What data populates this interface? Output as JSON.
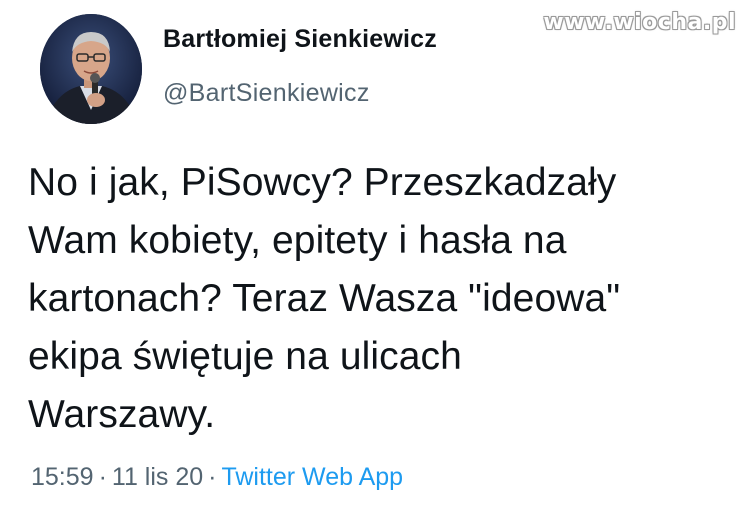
{
  "watermark": "www.wiocha.pl",
  "author": {
    "display_name": "Bartłomiej Sienkiewicz",
    "handle": "@BartSienkiewicz",
    "avatar_icon": "profile-photo"
  },
  "tweet": {
    "text": "No i jak, PiSowcy? Przeszkadzały\nWam kobiety, epitety i hasła na\nkartonach? Teraz Wasza \"ideowa\"\nekipa świętuje na ulicach\nWarszawy."
  },
  "meta": {
    "time": "15:59",
    "separator": "·",
    "date": "11 lis 20",
    "source": "Twitter Web App"
  },
  "colors": {
    "text": "#0f1419",
    "muted": "#536471",
    "link": "#1d9bf0"
  }
}
